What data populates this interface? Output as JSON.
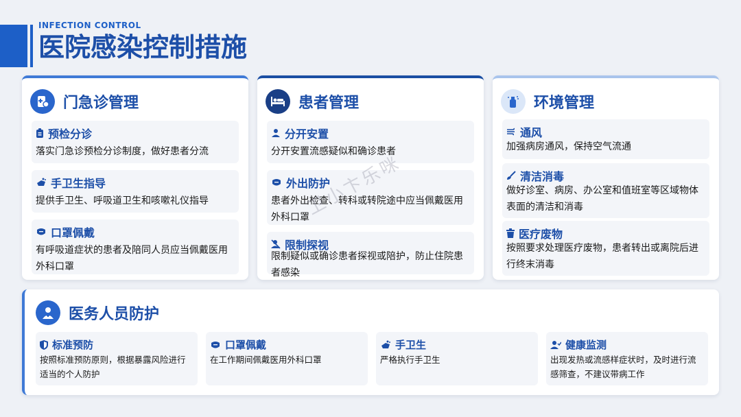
{
  "header": {
    "eyebrow": "INFECTION CONTROL",
    "title": "医院感染控制措施"
  },
  "colors": {
    "primary": "#1d4fa8",
    "accent": "#2a66cc",
    "navy": "#1a3f86",
    "light": "#dbe7f8"
  },
  "cards": [
    {
      "title": "门急诊管理",
      "icon": "clinic-icon",
      "items": [
        {
          "title": "预检分诊",
          "icon": "clipboard-icon",
          "text": "落实门急诊预检分诊制度，做好患者分流"
        },
        {
          "title": "手卫生指导",
          "icon": "hand-wash-icon",
          "text": "提供手卫生、呼吸道卫生和咳嗽礼仪指导"
        },
        {
          "title": "口罩佩戴",
          "icon": "mask-icon",
          "text": "有呼吸道症状的患者及陪同人员应当佩戴医用外科口罩"
        }
      ]
    },
    {
      "title": "患者管理",
      "icon": "hospital-bed-icon",
      "items": [
        {
          "title": "分开安置",
          "icon": "people-icon",
          "text": "分开安置流感疑似和确诊患者"
        },
        {
          "title": "外出防护",
          "icon": "mask-icon",
          "text": "患者外出检查、转科或转院途中应当佩戴医用外科口罩"
        },
        {
          "title": "限制探视",
          "icon": "no-visit-icon",
          "text": "限制疑似或确诊患者探视或陪护，防止住院患者感染"
        }
      ]
    },
    {
      "title": "环境管理",
      "icon": "spray-icon",
      "items": [
        {
          "title": "通风",
          "icon": "wind-icon",
          "text": "加强病房通风，保持空气流通"
        },
        {
          "title": "清洁消毒",
          "icon": "brush-icon",
          "text": "做好诊室、病房、办公室和值班室等区域物体表面的清洁和消毒"
        },
        {
          "title": "医疗废物",
          "icon": "trash-icon",
          "text": "按照要求处理医疗废物，患者转出或离院后进行终末消毒"
        }
      ]
    }
  ],
  "staff": {
    "title": "医务人员防护",
    "icon": "doctor-icon",
    "items": [
      {
        "title": "标准预防",
        "icon": "shield-icon",
        "text": "按照标准预防原则，根据暴露风险进行适当的个人防护"
      },
      {
        "title": "口罩佩戴",
        "icon": "mask-icon",
        "text": "在工作期间佩戴医用外科口罩"
      },
      {
        "title": "手卫生",
        "icon": "hand-wash-icon",
        "text": "严格执行手卫生"
      },
      {
        "title": "健康监测",
        "icon": "user-check-icon",
        "text": "出现发热或流感样症状时，及时进行流感筛查，不建议带病工作"
      }
    ]
  },
  "watermark": "卫小卞乐咪"
}
